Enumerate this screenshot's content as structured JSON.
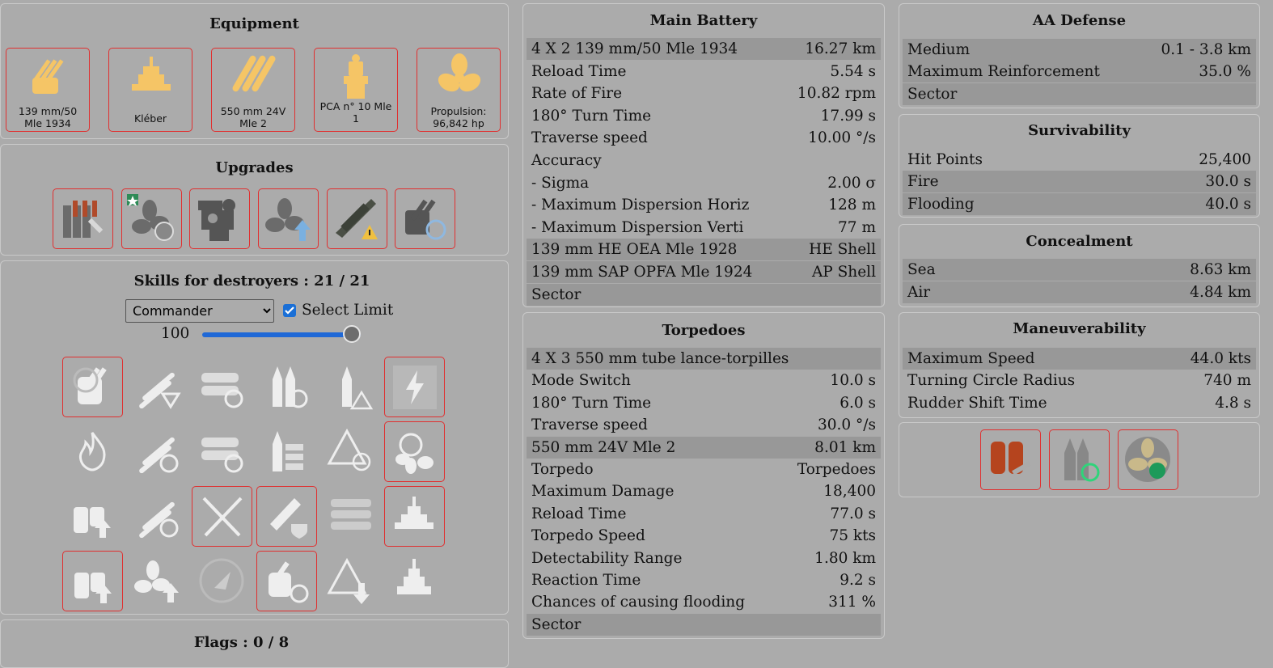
{
  "equipment": {
    "title": "Equipment",
    "items": [
      {
        "label": "139 mm/50 Mle 1934",
        "icon": "turret-icon"
      },
      {
        "label": "Kléber",
        "icon": "hull-icon"
      },
      {
        "label": "550 mm 24V Mle 2",
        "icon": "torpedo-tubes-icon"
      },
      {
        "label": "PCA n° 10 Mle 1",
        "icon": "fire-control-icon"
      },
      {
        "label": "Propulsion: 96,842 hp",
        "icon": "propeller-icon"
      }
    ]
  },
  "upgrades": {
    "title": "Upgrades",
    "items": [
      "main-armaments-mod-icon",
      "propulsion-mod-icon",
      "aiming-systems-mod-icon",
      "engine-boost-mod-icon",
      "aircraft-warning-mod-icon",
      "gun-reload-mod-icon"
    ]
  },
  "skills": {
    "title": "Skills for destroyers : 21 / 21",
    "commander_select": "Commander",
    "select_limit_label": "Select Limit",
    "slider_value": "100",
    "slider_fraction": 0.96
  },
  "flags": {
    "title": "Flags : 0 / 8"
  },
  "main_battery": {
    "title": "Main Battery",
    "rows": [
      {
        "k": "4 X 2 139 mm/50 Mle 1934",
        "v": "16.27 km",
        "hl": true
      },
      {
        "k": "Reload Time",
        "v": "5.54 s"
      },
      {
        "k": "Rate of Fire",
        "v": "10.82 rpm"
      },
      {
        "k": "180° Turn Time",
        "v": "17.99 s"
      },
      {
        "k": "Traverse speed",
        "v": "10.00 °/s"
      },
      {
        "k": "Accuracy",
        "v": ""
      },
      {
        "k": "- Sigma",
        "v": "2.00 σ"
      },
      {
        "k": "- Maximum Dispersion Horiz",
        "v": "128 m"
      },
      {
        "k": "- Maximum Dispersion Verti",
        "v": "77 m"
      },
      {
        "k": "139 mm HE OEA Mle 1928",
        "v": "HE Shell",
        "hl": true
      },
      {
        "k": "139 mm SAP OPFA Mle 1924",
        "v": "AP Shell",
        "hl": true
      },
      {
        "k": "Sector",
        "v": "",
        "hl": true
      }
    ]
  },
  "torpedoes": {
    "title": "Torpedoes",
    "rows": [
      {
        "k": "4 X 3 550 mm tube lance-torpilles",
        "v": "",
        "hl": true
      },
      {
        "k": "Mode Switch",
        "v": "10.0 s"
      },
      {
        "k": "180° Turn Time",
        "v": "6.0 s"
      },
      {
        "k": "Traverse speed",
        "v": "30.0 °/s"
      },
      {
        "k": "550 mm 24V Mle 2",
        "v": "8.01 km",
        "hl": true
      },
      {
        "k": "Torpedo",
        "v": "Torpedoes"
      },
      {
        "k": "Maximum Damage",
        "v": "18,400"
      },
      {
        "k": "Reload Time",
        "v": "77.0 s"
      },
      {
        "k": "Torpedo Speed",
        "v": "75 kts"
      },
      {
        "k": "Detectability Range",
        "v": "1.80 km"
      },
      {
        "k": "Reaction Time",
        "v": "9.2 s"
      },
      {
        "k": "Chances of causing flooding",
        "v": "311 %"
      },
      {
        "k": "Sector",
        "v": "",
        "hl": true
      }
    ]
  },
  "aa_defense": {
    "title": "AA Defense",
    "rows": [
      {
        "k": "Medium",
        "v": "0.1 - 3.8 km",
        "hl": true
      },
      {
        "k": "Maximum Reinforcement",
        "v": "35.0 %",
        "hl": true
      },
      {
        "k": "Sector",
        "v": "",
        "hl": true
      }
    ]
  },
  "survivability": {
    "title": "Survivability",
    "rows": [
      {
        "k": "Hit Points",
        "v": "25,400"
      },
      {
        "k": "Fire",
        "v": "30.0 s",
        "hl": true
      },
      {
        "k": "Flooding",
        "v": "40.0 s",
        "hl": true
      }
    ]
  },
  "concealment": {
    "title": "Concealment",
    "rows": [
      {
        "k": "Sea",
        "v": "8.63 km",
        "hl": true
      },
      {
        "k": "Air",
        "v": "4.84 km",
        "hl": true
      }
    ]
  },
  "maneuverability": {
    "title": "Maneuverability",
    "rows": [
      {
        "k": "Maximum Speed",
        "v": "44.0 kts",
        "hl": true
      },
      {
        "k": "Turning Circle Radius",
        "v": "740 m"
      },
      {
        "k": "Rudder Shift Time",
        "v": "4.8 s"
      }
    ]
  },
  "consumables": [
    "damage-control-icon",
    "smoke-reload-icon",
    "engine-boost-icon"
  ],
  "colors": {
    "bg": "#ababab",
    "highlight_row": "#989898",
    "selected_border": "#e03030",
    "equipment_icon": "#f5c566",
    "slider": "#1f68d6"
  }
}
